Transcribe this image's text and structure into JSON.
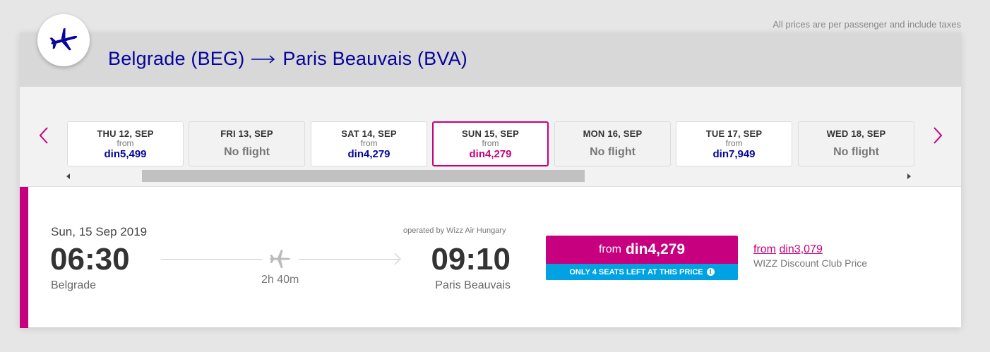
{
  "note": "All prices are per passenger and include taxes",
  "route": {
    "origin": "Belgrade (BEG)",
    "destination": "Paris Beauvais (BVA)"
  },
  "dates": [
    {
      "label": "THU 12, SEP",
      "from": "from",
      "price": "din5,499",
      "status": "available"
    },
    {
      "label": "FRI 13, SEP",
      "from": "",
      "price": "No flight",
      "status": "noflight"
    },
    {
      "label": "SAT 14, SEP",
      "from": "from",
      "price": "din4,279",
      "status": "available"
    },
    {
      "label": "SUN 15, SEP",
      "from": "from",
      "price": "din4,279",
      "status": "selected"
    },
    {
      "label": "MON 16, SEP",
      "from": "",
      "price": "No flight",
      "status": "noflight"
    },
    {
      "label": "TUE 17, SEP",
      "from": "from",
      "price": "din7,949",
      "status": "available"
    },
    {
      "label": "WED 18, SEP",
      "from": "",
      "price": "No flight",
      "status": "noflight"
    }
  ],
  "flight": {
    "date": "Sun, 15 Sep 2019",
    "departure_time": "06:30",
    "departure_city": "Belgrade",
    "operated_by": "operated by Wizz Air Hungary",
    "duration": "2h 40m",
    "arrival_time": "09:10",
    "arrival_city": "Paris Beauvais"
  },
  "price_button": {
    "from": "from",
    "price": "din4,279",
    "seats_note": "ONLY 4 SEATS LEFT AT THIS PRICE"
  },
  "club": {
    "from": "from",
    "price": "din3,079",
    "label": "WIZZ Discount Club Price"
  },
  "colors": {
    "brand_navy": "#06049a",
    "brand_magenta": "#c6007e",
    "seats_blue": "#00a2e1"
  },
  "icons": [
    "plane-icon",
    "chevron-left-icon",
    "chevron-right-icon",
    "arrow-right-icon",
    "info-icon"
  ]
}
